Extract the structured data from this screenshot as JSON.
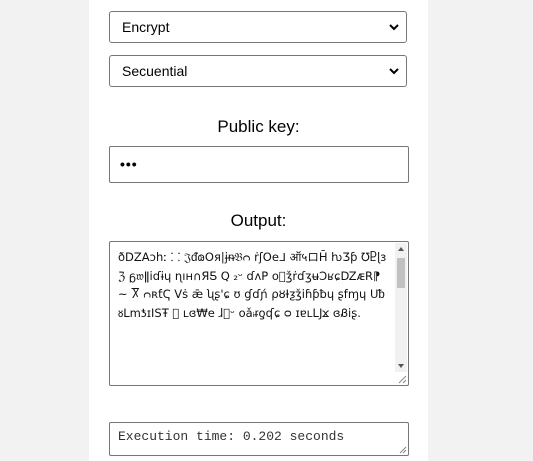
{
  "form": {
    "mode_select": {
      "value": "Encrypt"
    },
    "method_select": {
      "value": "Secuential"
    },
    "public_key_label": "Public key:",
    "public_key_input": {
      "value": "•••"
    },
    "output_label": "Output:",
    "output_text": "ðDZAɔhː ⸬ 𝔍ᵭ𐑀Oя|ɉᵰ𝔅ᴒ ṙʃOeᒧ ऑ५ロH̄ ƕƷƥ ℧Ⴒɭɜ ℨ ᵷ𝔴ǁiɗɨɥ ɳıʜ∩ЯƼ Q ₂ᵕ ɗᴧP o⃝ǯṙɗʒʉƆʁɕǱᴁR⁋ ~ Ⴟ ᴒʀƭҀ Vṡ ǣ ʯʂ'ɕ ʊ ɠɗɲ́ ρȣƗƺǯiɦƥƀɥ ʂfɱɥ Uᵬ ᴕLmƾɪISŦ ⃝ ʟɞ₩e ɺ𝔍ᵕ oǎᵢᵲƍʠɕ ᴑ ɪɐʟǇϫ ɞᏰiʂ.",
    "execution_time": "Execution time: 0.202 seconds"
  }
}
